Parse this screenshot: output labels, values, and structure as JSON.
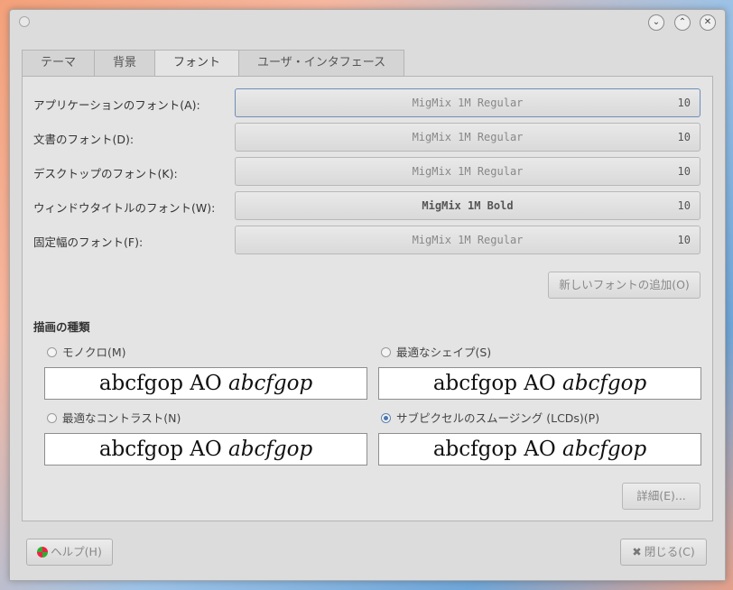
{
  "window": {
    "controls": {
      "minimize": "⌄",
      "maximize": "⌃",
      "close": "✕"
    }
  },
  "tabs": [
    {
      "label": "テーマ",
      "active": false
    },
    {
      "label": "背景",
      "active": false
    },
    {
      "label": "フォント",
      "active": true
    },
    {
      "label": "ユーザ・インタフェース",
      "active": false
    }
  ],
  "fonts": [
    {
      "label": "アプリケーションのフォント(A):",
      "name": "MigMix 1M Regular",
      "size": "10"
    },
    {
      "label": "文書のフォント(D):",
      "name": "MigMix 1M Regular",
      "size": "10"
    },
    {
      "label": "デスクトップのフォント(K):",
      "name": "MigMix 1M Regular",
      "size": "10"
    },
    {
      "label": "ウィンドウタイトルのフォント(W):",
      "name": "MigMix 1M Bold",
      "size": "10"
    },
    {
      "label": "固定幅のフォント(F):",
      "name": "MigMix 1M Regular",
      "size": "10"
    }
  ],
  "add_font_button": "新しいフォントの追加(O)",
  "rendering": {
    "heading": "描画の種類",
    "options": [
      {
        "label": "モノクロ(M)",
        "selected": false
      },
      {
        "label": "最適なシェイプ(S)",
        "selected": false
      },
      {
        "label": "最適なコントラスト(N)",
        "selected": false
      },
      {
        "label": "サブピクセルのスムージング (LCDs)(P)",
        "selected": true
      }
    ],
    "preview_regular": "abcfgop AO ",
    "preview_italic": "abcfgop"
  },
  "details_button": "詳細(E)...",
  "footer": {
    "help": "ヘルプ(H)",
    "close": "閉じる(C)"
  },
  "colors": {
    "accent": "#4a76b0",
    "window_bg": "#dcdcdc"
  }
}
